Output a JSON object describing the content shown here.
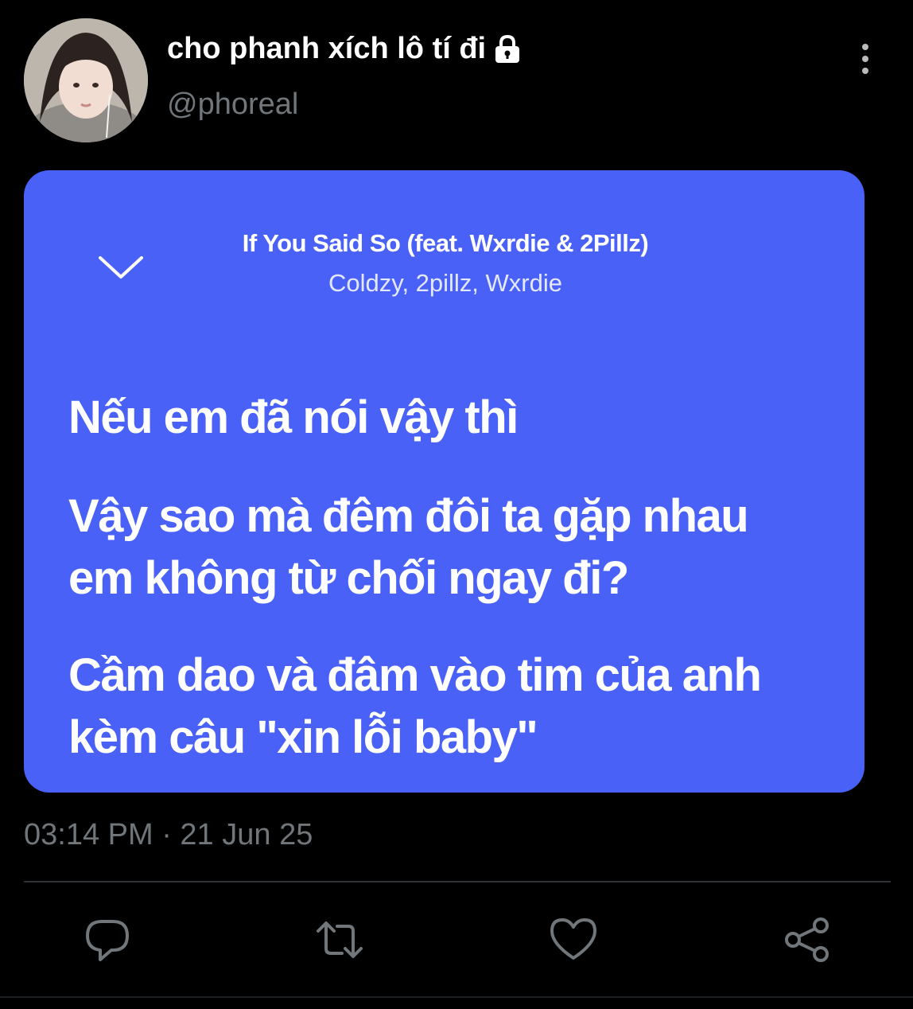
{
  "tweet": {
    "display_name": "cho phanh xích lô tí đi",
    "handle": "@phoreal",
    "timestamp": "03:14 PM · 21 Jun 25"
  },
  "lyrics_card": {
    "song_title": "If You Said So (feat. Wxrdie & 2Pillz)",
    "artists": "Coldzy, 2pillz, Wxrdie",
    "background_color": "#4a61f8",
    "lines": [
      "Nếu em đã nói vậy thì",
      "Vậy sao mà đêm đôi ta gặp nhau",
      "em không từ chối ngay đi?",
      "Cầm dao và đâm vào tim của anh",
      "kèm câu \"xin lỗi baby\""
    ]
  },
  "icons": {
    "lock": "lock-icon",
    "more": "more-vertical-icon",
    "collapse": "chevron-down-icon",
    "reply": "reply-icon",
    "retweet": "retweet-icon",
    "like": "heart-icon",
    "share": "share-icon"
  },
  "colors": {
    "background": "#000000",
    "primary_text": "#ffffff",
    "secondary_text": "#71767b",
    "divider": "#2f3336"
  }
}
